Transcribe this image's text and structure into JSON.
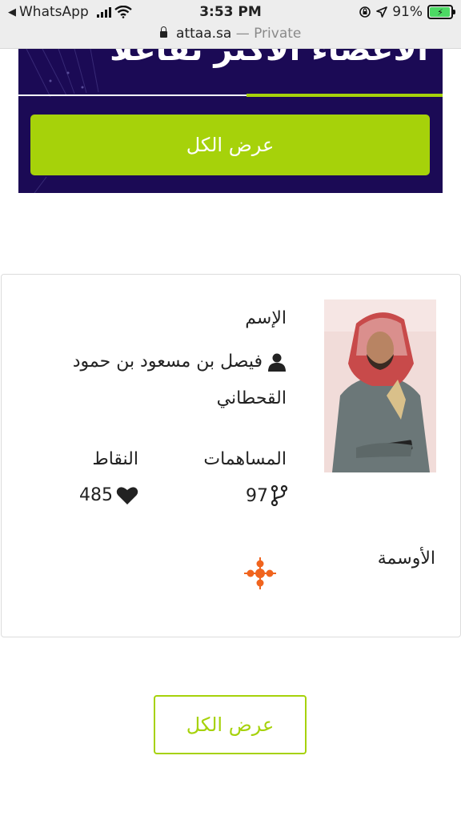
{
  "status_bar": {
    "back_app": "WhatsApp",
    "time": "3:53 PM",
    "battery": "91%",
    "url_domain": "attaa.sa",
    "url_suffix": "— Private"
  },
  "hero": {
    "title": "الأعضاء الأكثر تفاعلا",
    "view_all_label": "عرض الكل"
  },
  "member": {
    "name_label": "الإسم",
    "name": "فيصل بن مسعود بن حمود القحطاني",
    "contributions_label": "المساهمات",
    "contributions": "97",
    "points_label": "النقاط",
    "points": "485",
    "badges_label": "الأوسمة"
  },
  "footer": {
    "view_all_label": "عرض الكل"
  },
  "colors": {
    "accent_green": "#a6d20a",
    "hero_bg": "#1b0a55",
    "badge_orange": "#f0641e"
  }
}
